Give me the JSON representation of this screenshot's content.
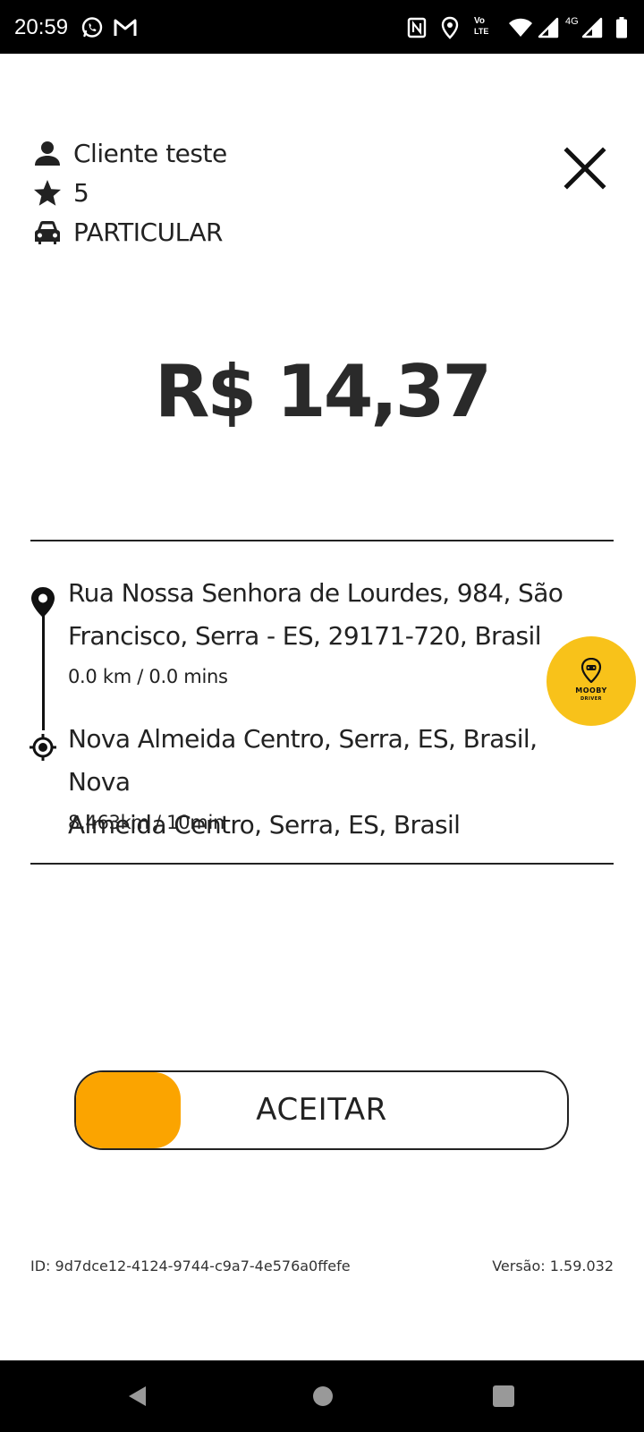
{
  "status_bar": {
    "time": "20:59",
    "icons_left": [
      "whatsapp-icon",
      "gmail-icon"
    ],
    "icons_right": [
      "nfc-icon",
      "location-icon",
      "volte-icon",
      "wifi-icon",
      "signal-icon",
      "signal-4g-icon",
      "battery-icon"
    ],
    "network_label": "4G",
    "volte_top": "Vo",
    "volte_bottom": "LTE"
  },
  "client": {
    "name": "Cliente teste",
    "rating": "5",
    "vehicle_category": "PARTICULAR"
  },
  "price": "R$ 14,37",
  "route": {
    "pickup": {
      "address_line1": "Rua Nossa Senhora de Lourdes, 984, São",
      "address_line2": "Francisco, Serra - ES, 29171-720, Brasil",
      "metric": "0.0 km / 0.0 mins"
    },
    "destination": {
      "address_line1": "Nova Almeida Centro, Serra, ES, Brasil, Nova",
      "address_line2": "Almeida Centro, Serra, ES, Brasil",
      "metric": "8.463km / 10min"
    }
  },
  "mooby": {
    "title": "MOOBY",
    "subtitle": "DRIVER",
    "color": "#f8c21a"
  },
  "accept": {
    "label": "ACEITAR",
    "handle_color": "#fba400",
    "progress": 0
  },
  "footer": {
    "id_text": "ID: 9d7dce12-4124-9744-c9a7-4e576a0ffefe",
    "version_text": "Versão: 1.59.032"
  },
  "nav_bar": {
    "buttons": [
      "back-icon",
      "home-icon",
      "recents-icon"
    ]
  }
}
